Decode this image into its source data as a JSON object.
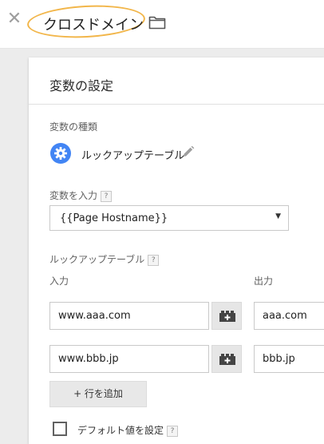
{
  "header": {
    "close_glyph": "✕",
    "title": "クロスドメイン",
    "highlight_color": "#f2b64a"
  },
  "panel": {
    "title": "変数の設定",
    "variable_type": {
      "label": "変数の種類",
      "name": "ルックアップテーブル",
      "icon": "gear-icon",
      "icon_color": "#4285f4"
    },
    "input_variable": {
      "label": "変数を入力",
      "help": "?",
      "selected": "{{Page Hostname}}"
    },
    "lookup_table": {
      "label": "ルックアップテーブル",
      "help": "?",
      "input_header": "入力",
      "output_header": "出力",
      "rows": [
        {
          "input": "www.aaa.com",
          "output": "aaa.com"
        },
        {
          "input": "www.bbb.jp",
          "output": "bbb.jp"
        }
      ],
      "add_row_label": "+ 行を追加"
    },
    "default_value": {
      "label": "デフォルト値を設定",
      "help": "?",
      "checked": false
    }
  }
}
